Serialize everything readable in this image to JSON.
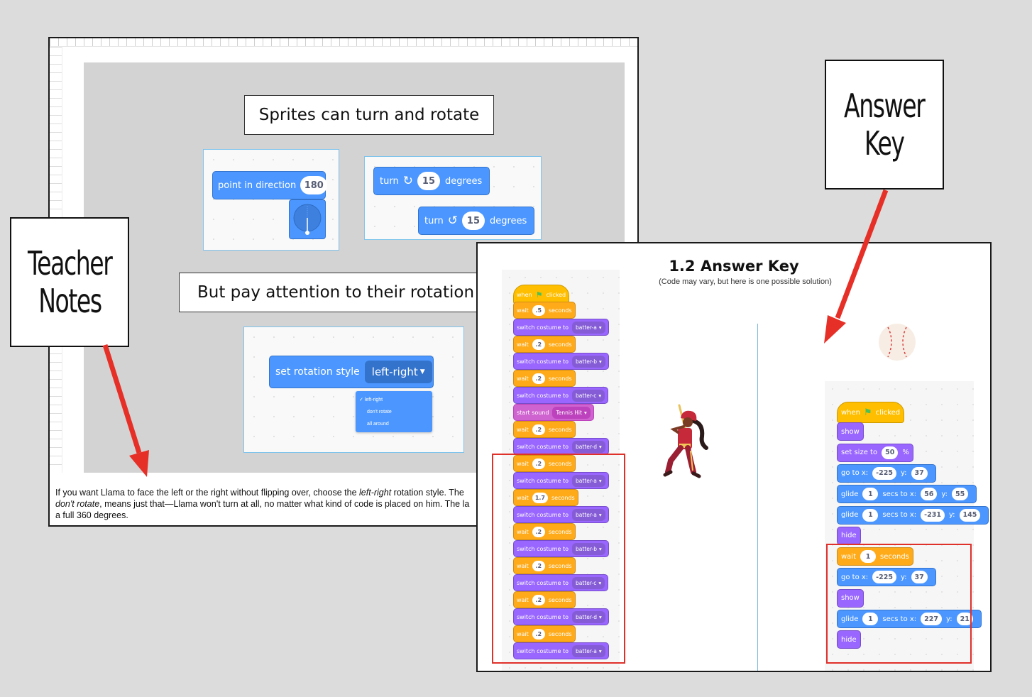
{
  "slide": {
    "title1": "Sprites can turn and rotate",
    "title2": "But pay attention to their rotation",
    "point_block": {
      "label": "point in direction",
      "value": "180"
    },
    "turn_right": {
      "label": "turn",
      "value": "15",
      "suffix": "degrees"
    },
    "turn_left": {
      "label": "turn",
      "value": "15",
      "suffix": "degrees"
    },
    "rotation_block": {
      "label": "set rotation style",
      "value": "left-right",
      "options": [
        "left-right",
        "don't rotate",
        "all around"
      ]
    },
    "ruler_left_marks": [
      "3",
      "2",
      "1",
      "1",
      "2",
      "3"
    ]
  },
  "notes": {
    "part1": "If you want Llama to face the left or the right without flipping over, choose the ",
    "italic1": "left-right",
    "part2": " rotation style. The",
    "italic2": "don't rotate",
    "part3": ", means just that—Llama won't turn at all, no matter what kind of code is placed on him. The la",
    "part4": "a full 360 degrees."
  },
  "answer_key": {
    "title": "1.2 Answer Key",
    "subtitle": "(Code may vary, but here is one possible solution)",
    "left_script": [
      {
        "cat": "events",
        "label": "when",
        "flag": true,
        "after": "clicked"
      },
      {
        "cat": "control",
        "label": "wait",
        "value": ".5",
        "after": "seconds"
      },
      {
        "cat": "looks",
        "label": "switch costume to",
        "dropdown": "batter-a"
      },
      {
        "cat": "control",
        "label": "wait",
        "value": ".2",
        "after": "seconds"
      },
      {
        "cat": "looks",
        "label": "switch costume to",
        "dropdown": "batter-b"
      },
      {
        "cat": "control",
        "label": "wait",
        "value": ".2",
        "after": "seconds"
      },
      {
        "cat": "looks",
        "label": "switch costume to",
        "dropdown": "batter-c"
      },
      {
        "cat": "sound",
        "label": "start sound",
        "dropdown": "Tennis Hit"
      },
      {
        "cat": "control",
        "label": "wait",
        "value": ".2",
        "after": "seconds"
      },
      {
        "cat": "looks",
        "label": "switch costume to",
        "dropdown": "batter-d"
      },
      {
        "cat": "control",
        "label": "wait",
        "value": ".2",
        "after": "seconds"
      },
      {
        "cat": "looks",
        "label": "switch costume to",
        "dropdown": "batter-a"
      },
      {
        "cat": "control",
        "label": "wait",
        "value": "1.7",
        "after": "seconds"
      },
      {
        "cat": "looks",
        "label": "switch costume to",
        "dropdown": "batter-a"
      },
      {
        "cat": "control",
        "label": "wait",
        "value": ".2",
        "after": "seconds"
      },
      {
        "cat": "looks",
        "label": "switch costume to",
        "dropdown": "batter-b"
      },
      {
        "cat": "control",
        "label": "wait",
        "value": ".2",
        "after": "seconds"
      },
      {
        "cat": "looks",
        "label": "switch costume to",
        "dropdown": "batter-c"
      },
      {
        "cat": "control",
        "label": "wait",
        "value": ".2",
        "after": "seconds"
      },
      {
        "cat": "looks",
        "label": "switch costume to",
        "dropdown": "batter-d"
      },
      {
        "cat": "control",
        "label": "wait",
        "value": ".2",
        "after": "seconds"
      },
      {
        "cat": "looks",
        "label": "switch costume to",
        "dropdown": "batter-a"
      }
    ],
    "right_script": [
      {
        "cat": "events",
        "label": "when",
        "flag": true,
        "after": "clicked"
      },
      {
        "cat": "looks",
        "label": "show"
      },
      {
        "cat": "looks",
        "label": "set size to",
        "value": "50",
        "after": "%"
      },
      {
        "cat": "motion",
        "label": "go to x:",
        "value": "-225",
        "after": "y:",
        "value2": "37"
      },
      {
        "cat": "motion",
        "label": "glide",
        "value": "1",
        "after": "secs to x:",
        "value2": "56",
        "after2": "y:",
        "value3": "55"
      },
      {
        "cat": "motion",
        "label": "glide",
        "value": "1",
        "after": "secs to x:",
        "value2": "-231",
        "after2": "y:",
        "value3": "145"
      },
      {
        "cat": "looks",
        "label": "hide"
      },
      {
        "cat": "control",
        "label": "wait",
        "value": "1",
        "after": "seconds"
      },
      {
        "cat": "motion",
        "label": "go to x:",
        "value": "-225",
        "after": "y:",
        "value2": "37"
      },
      {
        "cat": "looks",
        "label": "show"
      },
      {
        "cat": "motion",
        "label": "glide",
        "value": "1",
        "after": "secs to x:",
        "value2": "227",
        "after2": "y:",
        "value3": "21"
      },
      {
        "cat": "looks",
        "label": "hide"
      }
    ]
  },
  "labels": {
    "teacher_notes": [
      "Teacher",
      "Notes"
    ],
    "answer_key": [
      "Answer",
      "Key"
    ]
  },
  "colors": {
    "motion": "#4c97ff",
    "looks": "#9966ff",
    "control": "#ffab19",
    "events": "#ffbf00",
    "sound": "#cf63cf",
    "arrow": "#e63027"
  }
}
